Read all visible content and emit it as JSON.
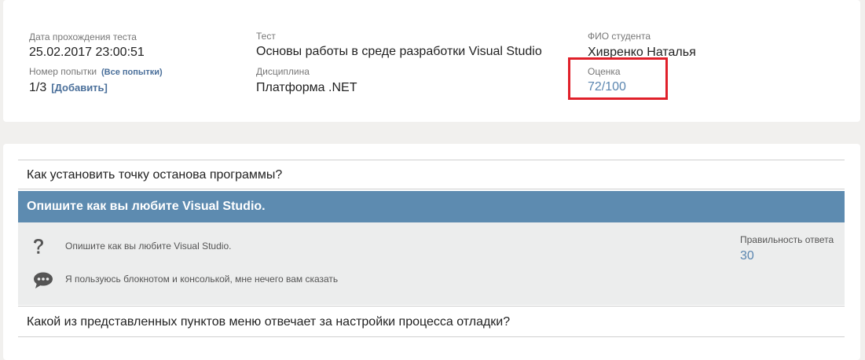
{
  "info": {
    "date_label": "Дата прохождения теста",
    "date_value": "25.02.2017 23:00:51",
    "attempt_label": "Номер попытки",
    "all_attempts_link": "(Все попытки)",
    "attempt_value": "1/3",
    "add_link": "[Добавить]",
    "test_label": "Тест",
    "test_value": "Основы работы в среде разработки Visual Studio",
    "discipline_label": "Дисциплина",
    "discipline_value": "Платформа .NET",
    "student_label": "ФИО студента",
    "student_value": "Хивренко Наталья",
    "score_label": "Оценка",
    "score_value": "72/100"
  },
  "questions": {
    "q1": "Как установить точку останова программы?",
    "q2_active": "Опишите как вы любите Visual Studio.",
    "q2_question": "Опишите как вы любите Visual Studio.",
    "q2_answer": "Я пользуюсь блокнотом и консолькой, мне нечего вам сказать",
    "correctness_label": "Правильность ответа",
    "correctness_value": "30",
    "q3": "Какой из представленных пунктов меню отвечает за настройки процесса отладки?"
  },
  "colors": {
    "accent": "#5d8bb0",
    "link": "#4a6f9a",
    "highlight_border": "#e0202a"
  },
  "icons": [
    "question-icon",
    "comment-icon"
  ]
}
